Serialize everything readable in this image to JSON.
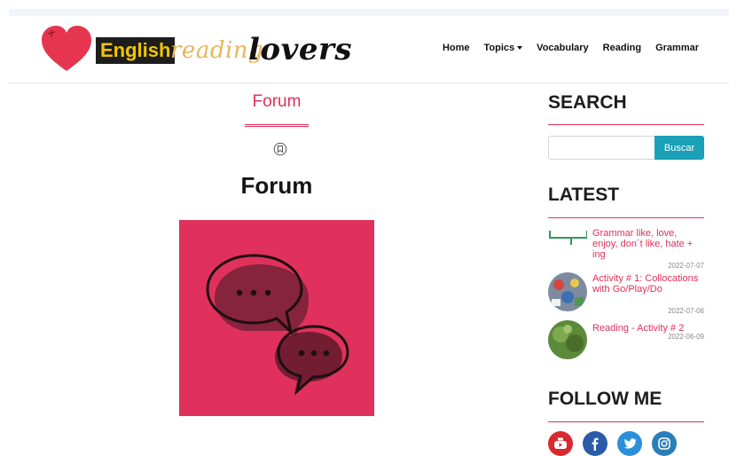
{
  "brand": {
    "word1": "English",
    "word2": "reading",
    "word3": "lovers"
  },
  "nav": {
    "items": [
      "Home",
      "Topics",
      "Vocabulary",
      "Reading",
      "Grammar"
    ]
  },
  "main": {
    "tab_label": "Forum",
    "title": "Forum",
    "hero_image": "chat-bubbles-icon"
  },
  "sidebar": {
    "search": {
      "heading": "SEARCH",
      "button_label": "Buscar",
      "value": ""
    },
    "latest": {
      "heading": "LATEST",
      "items": [
        {
          "title": "Grammar like, love, enjoy, don´t like, hate + ing",
          "date": "2022-07-07"
        },
        {
          "title": "Activity # 1: Collocations with Go/Play/Do",
          "date": "2022-07-06"
        },
        {
          "title": "Reading - Activity # 2",
          "date": "2022-06-09"
        }
      ]
    },
    "follow": {
      "heading": "FOLLOW ME",
      "networks": [
        "youtube-icon",
        "facebook-icon",
        "twitter-icon",
        "instagram-icon"
      ]
    }
  },
  "colors": {
    "accent": "#e03059",
    "button": "#1aa0b7"
  }
}
